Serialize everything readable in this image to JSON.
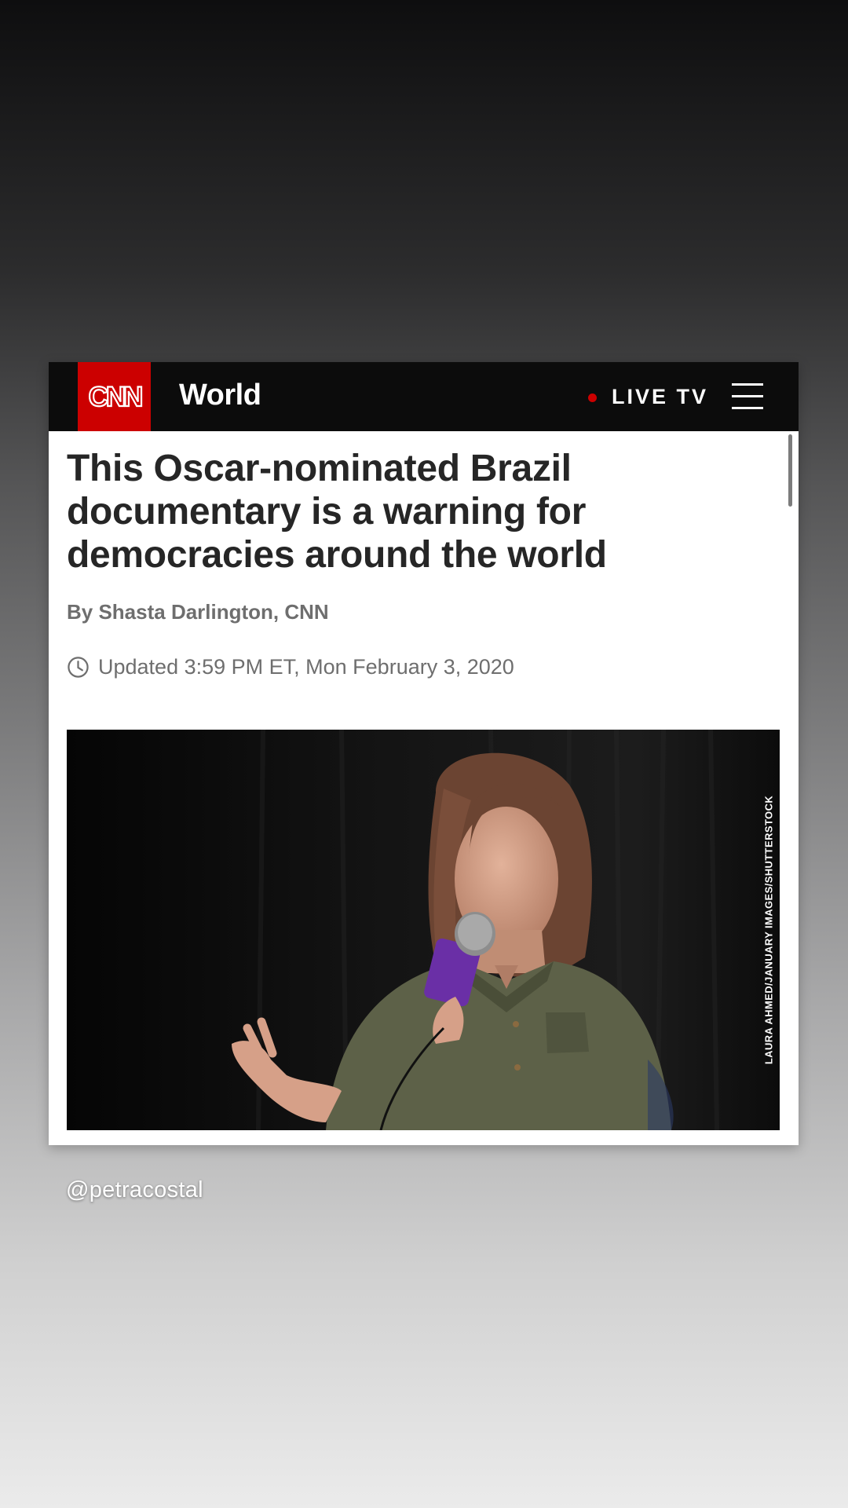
{
  "header": {
    "logo_text": "CNN",
    "section": "World",
    "live_label": "LIVE TV",
    "menu_icon": "hamburger-menu-icon",
    "logo_color": "#cc0000",
    "live_dot_color": "#cc0000"
  },
  "article": {
    "headline": "This Oscar-nominated Brazil documentary is a warning for democracies around the world",
    "byline": "By Shasta Darlington, CNN",
    "updated": "Updated 3:59 PM ET, Mon February 3, 2020",
    "updated_icon": "clock-icon",
    "photo_credit": "LAURA AHMED/JANUARY IMAGES/SHUTTERSTOCK"
  },
  "story": {
    "handle": "@petracostal"
  }
}
